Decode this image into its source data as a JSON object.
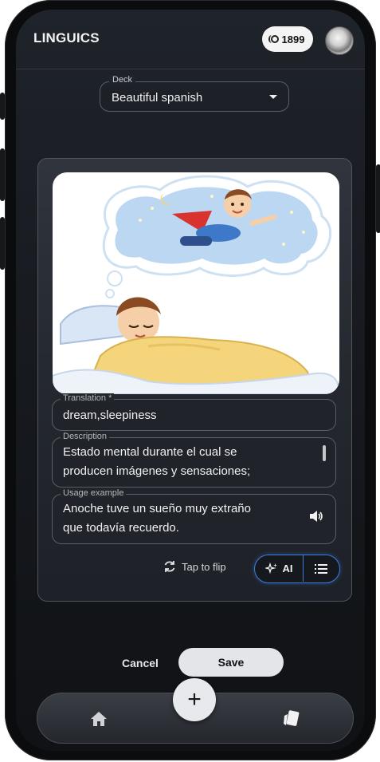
{
  "app": {
    "title": "LINGUICS"
  },
  "header": {
    "coins": "1899"
  },
  "deck": {
    "label": "Deck",
    "value": "Beautiful spanish"
  },
  "card": {
    "translation": {
      "label": "Translation *",
      "value": "dream,sleepiness"
    },
    "description": {
      "label": "Description",
      "value": "Estado mental durante el cual se\nproducen imágenes y sensaciones;"
    },
    "usage": {
      "label": "Usage example",
      "value": "Anoche tuve un sueño muy extraño\nque todavía recuerdo."
    },
    "flip_label": "Tap to flip",
    "ai_label": "AI"
  },
  "actions": {
    "cancel": "Cancel",
    "save": "Save"
  },
  "nav": {
    "fab": "+"
  },
  "colors": {
    "accent": "#3c7be0",
    "background": "#1a1d22",
    "primary_button": "#e4e5e8"
  },
  "icons": [
    "coin-icon",
    "avatar",
    "chevron-down-icon",
    "speaker-icon",
    "refresh-icon",
    "sparkles-icon",
    "list-icon",
    "home-icon",
    "cards-icon",
    "plus-icon"
  ]
}
